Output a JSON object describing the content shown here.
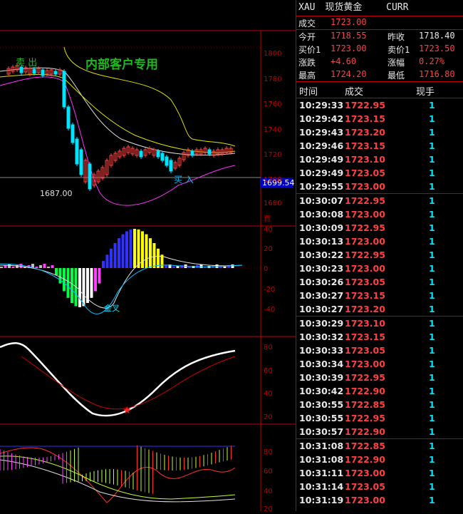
{
  "header": {
    "symbol": "XAU",
    "name": "现货黄金",
    "code": "CURR"
  },
  "quote": {
    "last": {
      "label": "成交",
      "value": "1723.00"
    },
    "open": {
      "label": "今开",
      "value": "1718.55"
    },
    "prev": {
      "label": "昨收",
      "value": "1718.40"
    },
    "bid": {
      "label": "买价1",
      "value": "1723.00"
    },
    "ask": {
      "label": "卖价1",
      "value": "1723.50"
    },
    "chg": {
      "label": "涨跌",
      "value": "+4.60"
    },
    "pct": {
      "label": "涨幅",
      "value": "0.27%"
    },
    "high": {
      "label": "最高",
      "value": "1724.20"
    },
    "low": {
      "label": "最低",
      "value": "1716.80"
    }
  },
  "ticks_header": {
    "time": "时间",
    "price": "成交",
    "vol": "现手"
  },
  "ticks": [
    {
      "t": "10:29:33",
      "p": "1722.95",
      "v": "1",
      "c": "up"
    },
    {
      "t": "10:29:42",
      "p": "1723.15",
      "v": "1",
      "c": "up"
    },
    {
      "t": "10:29:43",
      "p": "1723.20",
      "v": "1",
      "c": "up"
    },
    {
      "t": "10:29:46",
      "p": "1723.15",
      "v": "1",
      "c": "up"
    },
    {
      "t": "10:29:49",
      "p": "1723.10",
      "v": "1",
      "c": "up"
    },
    {
      "t": "10:29:49",
      "p": "1723.05",
      "v": "1",
      "c": "up"
    },
    {
      "t": "10:29:55",
      "p": "1723.00",
      "v": "1",
      "c": "up"
    },
    {
      "t": "10:30:07",
      "p": "1722.95",
      "v": "1",
      "c": "up",
      "gap": true
    },
    {
      "t": "10:30:08",
      "p": "1723.00",
      "v": "1",
      "c": "up"
    },
    {
      "t": "10:30:09",
      "p": "1722.95",
      "v": "1",
      "c": "up"
    },
    {
      "t": "10:30:13",
      "p": "1723.00",
      "v": "1",
      "c": "up"
    },
    {
      "t": "10:30:22",
      "p": "1722.95",
      "v": "1",
      "c": "up"
    },
    {
      "t": "10:30:23",
      "p": "1723.00",
      "v": "1",
      "c": "up"
    },
    {
      "t": "10:30:26",
      "p": "1723.05",
      "v": "1",
      "c": "up"
    },
    {
      "t": "10:30:27",
      "p": "1723.15",
      "v": "1",
      "c": "up"
    },
    {
      "t": "10:30:27",
      "p": "1723.20",
      "v": "1",
      "c": "up"
    },
    {
      "t": "10:30:29",
      "p": "1723.10",
      "v": "1",
      "c": "up",
      "gap": true
    },
    {
      "t": "10:30:32",
      "p": "1723.15",
      "v": "1",
      "c": "up"
    },
    {
      "t": "10:30:33",
      "p": "1723.05",
      "v": "1",
      "c": "up"
    },
    {
      "t": "10:30:34",
      "p": "1723.00",
      "v": "1",
      "c": "up"
    },
    {
      "t": "10:30:39",
      "p": "1722.95",
      "v": "1",
      "c": "up"
    },
    {
      "t": "10:30:42",
      "p": "1722.90",
      "v": "1",
      "c": "up"
    },
    {
      "t": "10:30:55",
      "p": "1722.85",
      "v": "1",
      "c": "up"
    },
    {
      "t": "10:30:55",
      "p": "1722.95",
      "v": "1",
      "c": "up"
    },
    {
      "t": "10:30:57",
      "p": "1722.90",
      "v": "1",
      "c": "up"
    },
    {
      "t": "10:31:08",
      "p": "1722.85",
      "v": "1",
      "c": "up",
      "gap": true
    },
    {
      "t": "10:31:08",
      "p": "1722.90",
      "v": "1",
      "c": "up"
    },
    {
      "t": "10:31:11",
      "p": "1723.00",
      "v": "1",
      "c": "up"
    },
    {
      "t": "10:31:14",
      "p": "1723.05",
      "v": "1",
      "c": "up"
    },
    {
      "t": "10:31:19",
      "p": "1723.00",
      "v": "1",
      "c": "up"
    }
  ],
  "chart": {
    "watermark": "内部客户专用",
    "sell_label": "卖 出",
    "buy_label": "买 入",
    "low_label": "1687.00",
    "current_price": "1699.54",
    "price_axis": [
      "1800",
      "1780",
      "1760",
      "1740",
      "1720",
      "1700",
      "1680"
    ],
    "axis_tag": "百",
    "macd_axis": [
      "40",
      "20",
      "0",
      "-20",
      "-40"
    ],
    "macd_cross": "金叉",
    "kd_axis": [
      "80",
      "60",
      "40",
      "20"
    ],
    "bot_axis": [
      "80",
      "60",
      "40",
      "20"
    ],
    "colors": {
      "up": "#ff4040",
      "down": "#00e5ff",
      "grid": "#c00000"
    }
  }
}
